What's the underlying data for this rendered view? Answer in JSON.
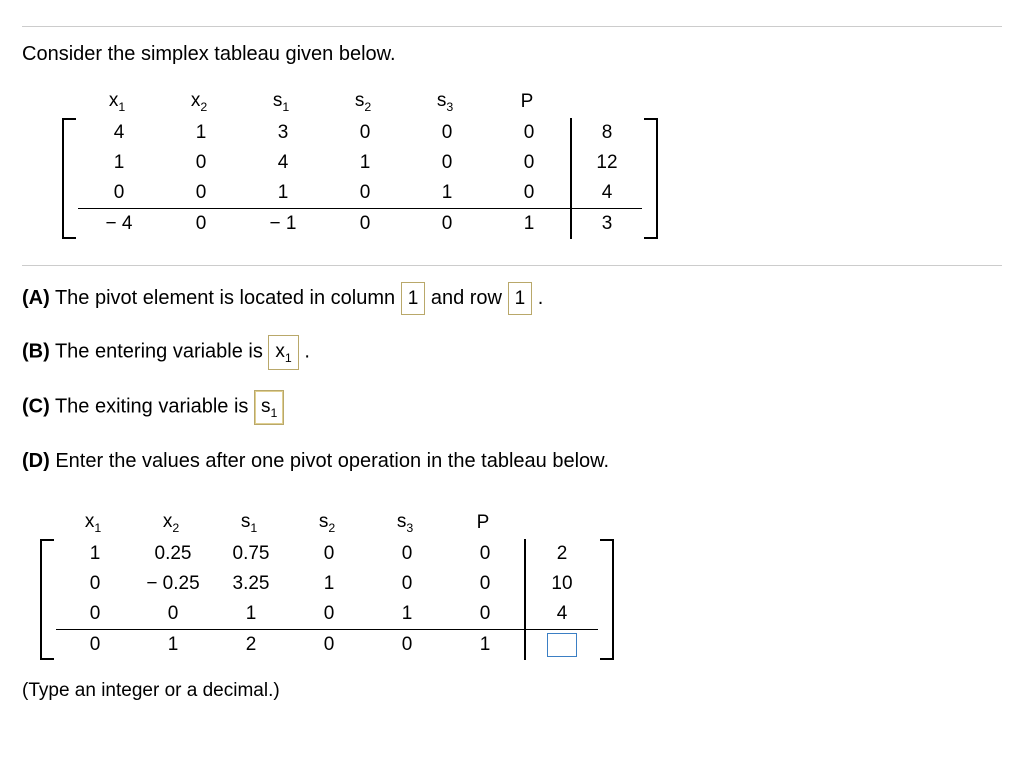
{
  "intro": "Consider the simplex tableau given below.",
  "headers": {
    "x1": "x",
    "x1s": "1",
    "x2": "x",
    "x2s": "2",
    "s1": "s",
    "s1s": "1",
    "s2": "s",
    "s2s": "2",
    "s3": "s",
    "s3s": "3",
    "P": "P"
  },
  "t1": {
    "r1": [
      "4",
      "1",
      "3",
      "0",
      "0",
      "0",
      "8"
    ],
    "r2": [
      "1",
      "0",
      "4",
      "1",
      "0",
      "0",
      "12"
    ],
    "r3": [
      "0",
      "0",
      "1",
      "0",
      "1",
      "0",
      "4"
    ],
    "r4": [
      "− 4",
      "0",
      "− 1",
      "0",
      "0",
      "1",
      "3"
    ]
  },
  "qA": {
    "label": "(A)",
    "t1": "The pivot element is located in column ",
    "v1": "1",
    "t2": " and row ",
    "v2": "1",
    "t3": "."
  },
  "qB": {
    "label": "(B)",
    "t1": "The entering variable is ",
    "var": "x",
    "sub": "1",
    "t2": "."
  },
  "qC": {
    "label": "(C)",
    "t1": "The exiting variable is ",
    "var": "s",
    "sub": "1"
  },
  "qD": {
    "label": "(D)",
    "t1": "Enter the values after one pivot operation in the tableau below."
  },
  "t2": {
    "r1": [
      "1",
      "0.25",
      "0.75",
      "0",
      "0",
      "0",
      "2"
    ],
    "r2": [
      "0",
      "− 0.25",
      "3.25",
      "1",
      "0",
      "0",
      "10"
    ],
    "r3": [
      "0",
      "0",
      "1",
      "0",
      "1",
      "0",
      "4"
    ],
    "r4": [
      "0",
      "1",
      "2",
      "0",
      "0",
      "1",
      ""
    ]
  },
  "hint": "(Type an integer or a decimal.)"
}
